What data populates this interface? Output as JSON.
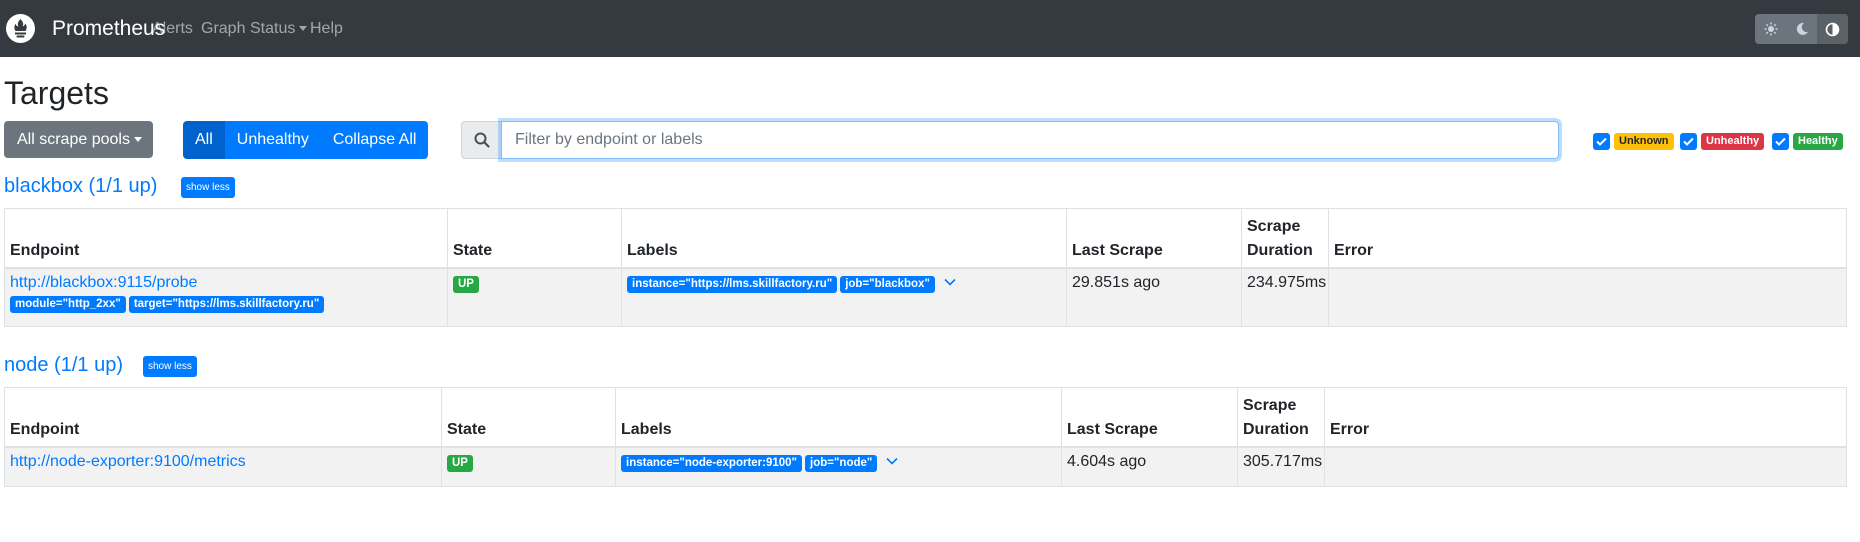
{
  "navbar": {
    "brand": "Prometheus",
    "links": [
      "Alerts",
      "Graph",
      "Status",
      "Help"
    ]
  },
  "page_title": "Targets",
  "toolbar": {
    "pool_select": "All scrape pools",
    "filter_buttons": [
      "All",
      "Unhealthy",
      "Collapse All"
    ],
    "search_placeholder": "Filter by endpoint or labels",
    "status_filters": [
      {
        "label": "Unknown",
        "color": "#ffc107",
        "text_color": "#212529"
      },
      {
        "label": "Unhealthy",
        "color": "#dc3545",
        "text_color": "#ffffff"
      },
      {
        "label": "Healthy",
        "color": "#28a745",
        "text_color": "#ffffff"
      }
    ]
  },
  "columns": {
    "endpoint": "Endpoint",
    "state": "State",
    "labels": "Labels",
    "last_scrape": "Last Scrape",
    "scrape_duration_line1": "Scrape",
    "scrape_duration_line2": "Duration",
    "error": "Error"
  },
  "pools": [
    {
      "title": "blackbox (1/1 up)",
      "toggle": "show less",
      "target": {
        "endpoint": "http://blackbox:9115/probe",
        "params": [
          "module=\"http_2xx\"",
          "target=\"https://lms.skillfactory.ru\""
        ],
        "state": "UP",
        "labels": [
          "instance=\"https://lms.skillfactory.ru\"",
          "job=\"blackbox\""
        ],
        "last_scrape": "29.851s ago",
        "scrape_duration": "234.975ms",
        "error": ""
      }
    },
    {
      "title": "node (1/1 up)",
      "toggle": "show less",
      "target": {
        "endpoint": "http://node-exporter:9100/metrics",
        "state": "UP",
        "labels": [
          "instance=\"node-exporter:9100\"",
          "job=\"node\""
        ],
        "last_scrape": "4.604s ago",
        "scrape_duration": "305.717ms",
        "error": ""
      }
    }
  ]
}
